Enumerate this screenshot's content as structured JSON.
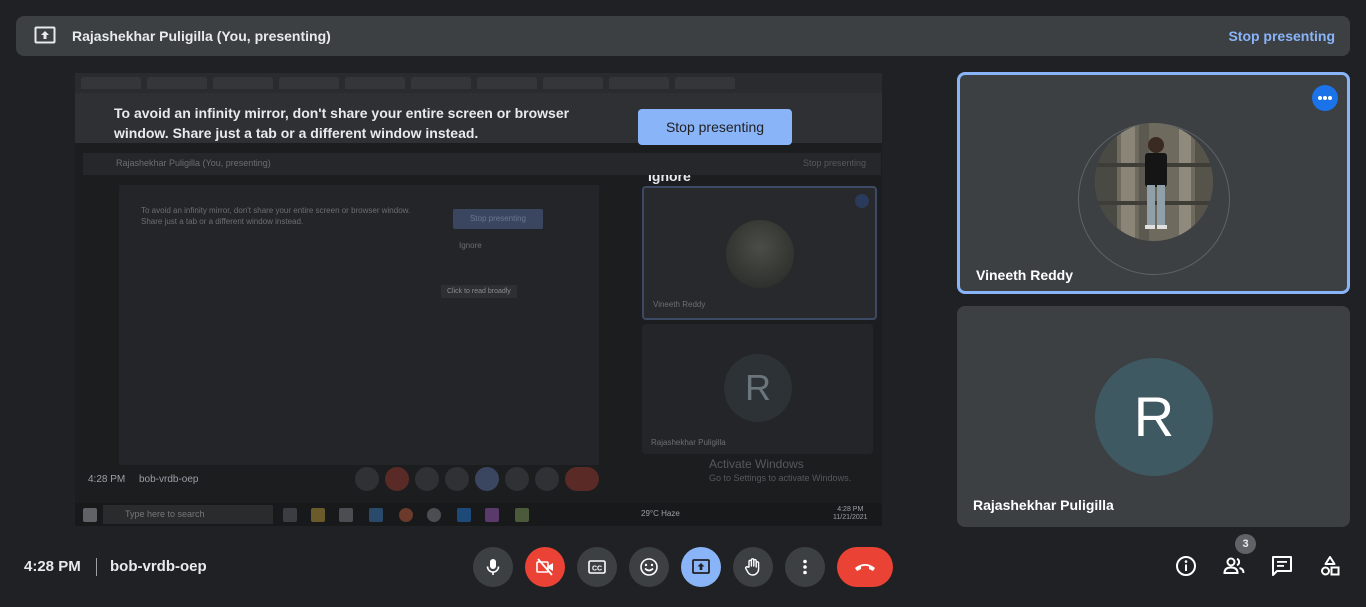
{
  "present_bar": {
    "title": "Rajashekhar Puligilla (You, presenting)",
    "stop_label": "Stop presenting"
  },
  "shared_screen": {
    "warning": "To avoid an infinity mirror, don't share your entire screen or browser window. Share just a tab or a different window instead.",
    "stop_label": "Stop presenting",
    "ignore_label": "Ignore",
    "nested": {
      "title": "Rajashekhar Puligilla (You, presenting)",
      "stop_label": "Stop presenting",
      "warning": "To avoid an infinity mirror, don't share your entire screen or browser window. Share just a tab or a different window instead.",
      "ignore_label": "Ignore",
      "tooltip": "Click to read broadly",
      "tile1_name": "Vineeth Reddy",
      "tile2_name": "Rajashekhar Puligilla",
      "tile2_initial": "R",
      "time": "4:28 PM",
      "code": "bob-vrdb-oep"
    },
    "activate_title": "Activate Windows",
    "activate_sub": "Go to Settings to activate Windows.",
    "taskbar": {
      "search_placeholder": "Type here to search",
      "weather": "29°C  Haze",
      "clock_time": "4:28 PM",
      "clock_date": "11/21/2021"
    }
  },
  "participants": [
    {
      "name": "Vineeth Reddy",
      "highlighted": true
    },
    {
      "name": "Rajashekhar Puligilla",
      "initial": "R",
      "avatar_color": "#3f5962"
    }
  ],
  "meeting": {
    "time": "4:28 PM",
    "code": "bob-vrdb-oep"
  },
  "controls": [
    {
      "name": "mic-button",
      "icon": "mic-icon"
    },
    {
      "name": "camera-button",
      "icon": "camera-off-icon",
      "state": "off",
      "color": "#ea4335"
    },
    {
      "name": "captions-button",
      "icon": "captions-icon"
    },
    {
      "name": "reactions-button",
      "icon": "emoji-icon"
    },
    {
      "name": "present-button",
      "icon": "present-icon",
      "state": "active",
      "color": "#8ab4f8"
    },
    {
      "name": "raise-hand-button",
      "icon": "hand-icon"
    },
    {
      "name": "more-options-button",
      "icon": "more-vert-icon"
    },
    {
      "name": "leave-call-button",
      "icon": "call-end-icon",
      "color": "#ea4335"
    }
  ],
  "right_controls": {
    "people_count": "3"
  },
  "colors": {
    "background": "#202124",
    "surface": "#3c4043",
    "accent": "#8ab4f8",
    "danger": "#ea4335"
  }
}
